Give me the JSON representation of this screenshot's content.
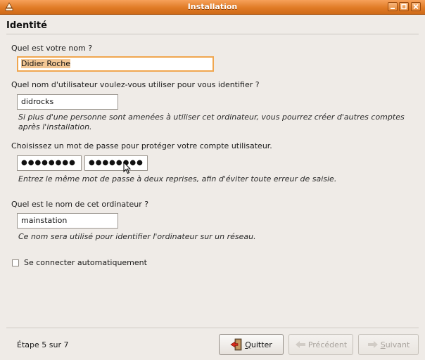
{
  "window": {
    "title": "Installation",
    "controls": [
      "minimize-icon",
      "maximize-icon",
      "close-icon"
    ]
  },
  "header": {
    "title": "Identité"
  },
  "form": {
    "name_label": "Quel est votre nom ?",
    "name_value": "Didier Roche",
    "username_label": "Quel nom d'utilisateur voulez-vous utiliser pour vous identifier ?",
    "username_value": "didrocks",
    "username_hint": "Si plus d'une personne sont amenées à utiliser cet ordinateur, vous pourrez créer d'autres comptes après l'installation.",
    "password_label": "Choisissez un mot de passe pour protéger votre compte utilisateur.",
    "password_value": "●●●●●●●●",
    "password_confirm_value": "●●●●●●●●",
    "password_hint": "Entrez le même mot de passe à deux reprises, afin d'éviter toute erreur de saisie.",
    "hostname_label": "Quel est le nom de cet ordinateur ?",
    "hostname_value": "mainstation",
    "hostname_hint": "Ce nom sera utilisé pour identifier l'ordinateur sur un réseau.",
    "autologin_label": "Se connecter automatiquement",
    "autologin_checked": false
  },
  "footer": {
    "step": "Étape 5 sur 7",
    "quit_label": "uitter",
    "quit_mnemonic": "Q",
    "previous_label": "Précédent",
    "next_label": "uivant",
    "next_mnemonic": "S"
  },
  "colors": {
    "titlebar": "#e07b26",
    "focus_border": "#f0a64f",
    "selection": "#f3c795",
    "window_bg": "#efebe7"
  }
}
